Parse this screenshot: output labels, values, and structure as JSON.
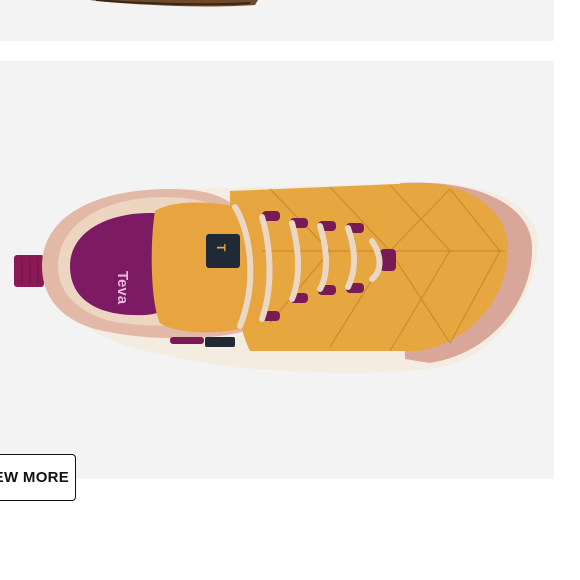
{
  "product_card": {
    "brand_logo_text": "Teva"
  },
  "actions": {
    "view_more_label": "VIEW MORE"
  },
  "colors": {
    "card_background": "#f3f3f3",
    "shoe_upper": "#e6a640",
    "shoe_suede": "#d9a79a",
    "lining": "#8a1f6e",
    "laces": "#ead8c6",
    "outsole": "#f4ece0"
  },
  "icons": [
    "teva-logo-icon",
    "pull-tab-icon",
    "tongue-label-icon"
  ]
}
